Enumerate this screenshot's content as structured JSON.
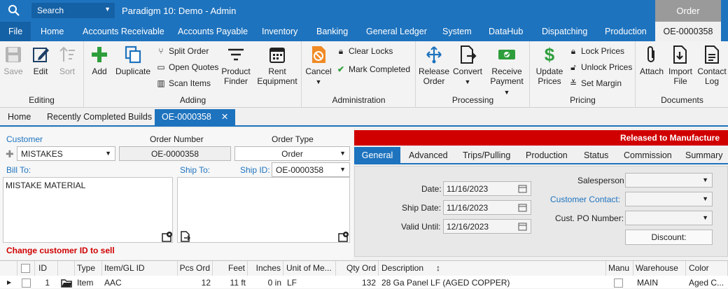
{
  "titlebar": {
    "search_label": "Search",
    "app_title": "Paradigm 10: Demo - Admin",
    "context_label": "Order"
  },
  "menu": {
    "file": "File",
    "items": [
      "Home",
      "Accounts Receivable",
      "Accounts Payable",
      "Inventory",
      "Banking",
      "General Ledger",
      "System",
      "DataHub",
      "Dispatching",
      "Production"
    ],
    "active_doc": "OE-0000358"
  },
  "ribbon": {
    "editing": {
      "label": "Editing",
      "save": "Save",
      "edit": "Edit",
      "sort": "Sort"
    },
    "adding": {
      "label": "Adding",
      "add": "Add",
      "duplicate": "Duplicate",
      "split_order": "Split Order",
      "open_quotes": "Open Quotes",
      "scan_items": "Scan Items",
      "product_finder_1": "Product",
      "product_finder_2": "Finder",
      "rent_1": "Rent",
      "rent_2": "Equipment"
    },
    "administration": {
      "label": "Administration",
      "cancel": "Cancel",
      "clear_locks": "Clear Locks",
      "mark_completed": "Mark Completed"
    },
    "processing": {
      "label": "Processing",
      "release_1": "Release",
      "release_2": "Order",
      "convert": "Convert",
      "receive_1": "Receive",
      "receive_2": "Payment"
    },
    "pricing": {
      "label": "Pricing",
      "update_1": "Update",
      "update_2": "Prices",
      "lock_prices": "Lock Prices",
      "unlock_prices": "Unlock Prices",
      "set_margin": "Set Margin"
    },
    "documents": {
      "label": "Documents",
      "attach": "Attach",
      "import_1": "Import",
      "import_2": "File",
      "contact_1": "Contact",
      "contact_2": "Log"
    }
  },
  "doc_tabs": [
    "Home",
    "Recently Completed Builds",
    "OE-0000358"
  ],
  "form": {
    "customer_label": "Customer",
    "customer_value": "MISTAKES",
    "order_number_label": "Order Number",
    "order_number_value": "OE-0000358",
    "order_type_label": "Order Type",
    "order_type_value": "Order",
    "bill_to_label": "Bill To:",
    "bill_to_value": "MISTAKE MATERIAL",
    "ship_to_label": "Ship To:",
    "ship_id_label": "Ship ID:",
    "ship_id_value": "OE-0000358",
    "warning": "Change customer ID to sell"
  },
  "status_banner": "Released to Manufacture",
  "sub_tabs": [
    "General",
    "Advanced",
    "Trips/Pulling",
    "Production",
    "Status",
    "Commission",
    "Summary"
  ],
  "general": {
    "date_label": "Date:",
    "date_value": "11/16/2023",
    "ship_date_label": "Ship Date:",
    "ship_date_value": "11/16/2023",
    "valid_until_label": "Valid Until:",
    "valid_until_value": "12/16/2023",
    "salesperson_label": "Salesperson",
    "customer_contact_label": "Customer Contact:",
    "cust_po_label": "Cust. PO Number:",
    "discount_label": "Discount:"
  },
  "grid": {
    "columns": [
      "ID",
      "Type",
      "Item/GL ID",
      "Pcs Ord",
      "Feet",
      "Inches",
      "Unit of Me...",
      "Qty Ord",
      "Description",
      "Manu",
      "Warehouse",
      "Color"
    ],
    "rows": [
      {
        "id": "1",
        "type": "Item",
        "item": "AAC",
        "pcs": "12",
        "feet": "11 ft",
        "inches": "0 in",
        "unit": "LF",
        "qty": "132",
        "description": "28 Ga Panel LF (AGED COPPER)",
        "warehouse": "MAIN",
        "color": "Aged  C..."
      }
    ]
  },
  "colors": {
    "brand": "#1e73be",
    "alert": "#d00000",
    "add_green": "#2e9e3c",
    "cancel_orange": "#f08a24"
  }
}
